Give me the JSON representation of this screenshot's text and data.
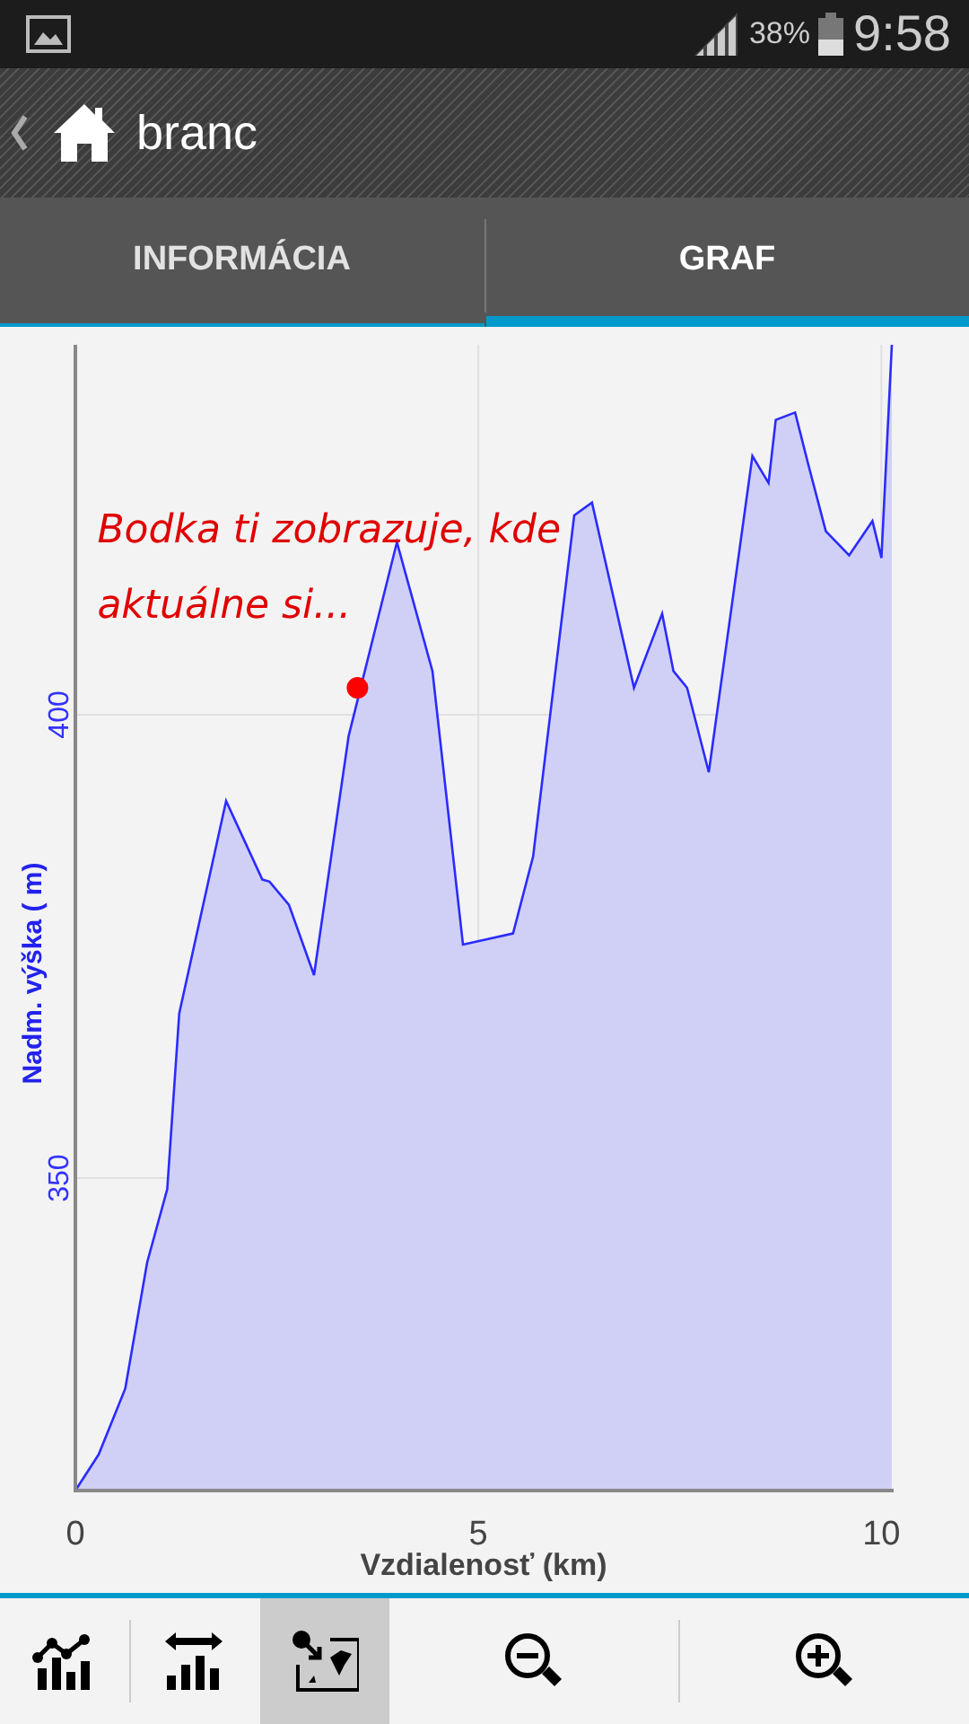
{
  "status_bar": {
    "battery_text": "38%",
    "time": "9:58"
  },
  "action_bar": {
    "title": "branc"
  },
  "tabs": [
    {
      "label": "INFORMÁCIA",
      "selected": false
    },
    {
      "label": "GRAF",
      "selected": true
    }
  ],
  "chart": {
    "chart_data": {
      "type": "area",
      "xlabel": "Vzdialenosť (km)",
      "ylabel": "Nadm. výška ( m)",
      "x": [
        0,
        0.29,
        0.62,
        0.89,
        1.14,
        1.29,
        1.87,
        2.32,
        2.41,
        2.65,
        2.96,
        3.39,
        3.99,
        4.43,
        4.81,
        5.43,
        5.68,
        6.19,
        6.41,
        6.93,
        7.28,
        7.42,
        7.59,
        7.86,
        8.4,
        8.6,
        8.69,
        8.93,
        9.09,
        9.31,
        9.6,
        9.89,
        10.0,
        10.13
      ],
      "grid": true,
      "series": [
        {
          "color": "#2b2bff",
          "values": [
            316.3,
            320.2,
            327.3,
            340.9,
            348.8,
            367.8,
            390.7,
            382.2,
            382.0,
            379.5,
            371.9,
            397.7,
            418.6,
            404.7,
            375.2,
            376.4,
            384.7,
            421.5,
            422.9,
            402.9,
            410.9,
            404.7,
            402.9,
            393.8,
            427.9,
            425.0,
            431.8,
            432.6,
            427.1,
            419.8,
            417.2,
            420.9,
            416.9,
            439.9
          ]
        }
      ],
      "xlim": [
        0,
        10.13
      ],
      "ylim": [
        316.3,
        439.9
      ],
      "xticks": [
        0,
        5,
        10
      ],
      "yticks": [
        350,
        400
      ],
      "annotations": [
        {
          "x": 3.5,
          "y": 402.9,
          "text": "Bodka ti zobrazuje, kde aktuálne si..."
        }
      ]
    }
  },
  "toolbar": [
    {
      "kind": "line-bars",
      "selected": false
    },
    {
      "kind": "bars-width",
      "selected": false
    },
    {
      "kind": "pointer-map",
      "selected": true
    },
    {
      "kind": "zoom-out",
      "selected": false
    },
    {
      "kind": "zoom-in",
      "selected": false
    }
  ]
}
